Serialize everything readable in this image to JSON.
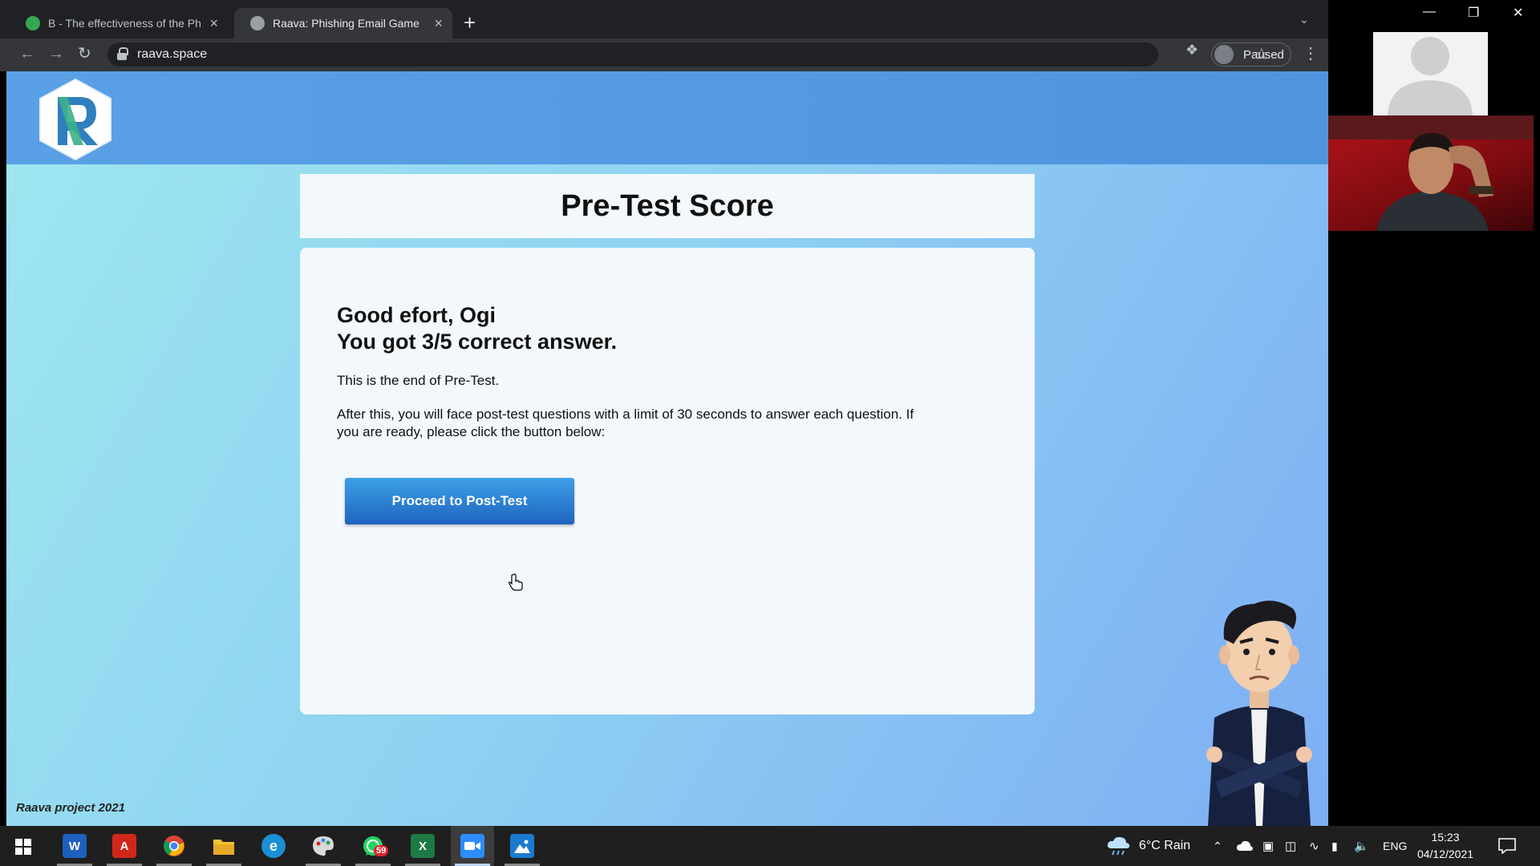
{
  "browser": {
    "tabs": [
      {
        "title": "B - The effectiveness of the Ph",
        "favicon": "drive-icon",
        "active": false
      },
      {
        "title": "Raava: Phishing Email Game",
        "favicon": "globe-icon",
        "active": true
      }
    ],
    "url": "raava.space",
    "profile_label": "Paused"
  },
  "page": {
    "title": "Pre-Test Score",
    "greeting_line1": "Good efort, Ogi",
    "greeting_line2": "You got 3/5 correct answer.",
    "end_text": "This is the end of Pre-Test.",
    "instructions": "After this, you will face post-test questions with a limit of 30 seconds to answer each question. If you are ready, please click the button below:",
    "button_label": "Proceed to Post-Test",
    "footer": "Raava project 2021",
    "colors": {
      "header": "#5aa0e6",
      "button": "#1f64bf",
      "card": "#f3f8fd"
    }
  },
  "taskbar": {
    "apps": [
      {
        "name": "Word",
        "glyph": "W",
        "color": "#1f5fbf"
      },
      {
        "name": "Acrobat",
        "glyph": "A",
        "color": "#d1271b"
      },
      {
        "name": "Chrome",
        "glyph": "",
        "color": "#e8eaed"
      },
      {
        "name": "File Explorer",
        "glyph": "",
        "color": "#f3c332"
      },
      {
        "name": "Edge",
        "glyph": "e",
        "color": "#1a8fd6"
      },
      {
        "name": "Paint",
        "glyph": "",
        "color": "#d9d9d9"
      },
      {
        "name": "WhatsApp",
        "glyph": "",
        "color": "#25d366",
        "badge": "59"
      },
      {
        "name": "Excel",
        "glyph": "X",
        "color": "#1d7a44"
      },
      {
        "name": "Zoom",
        "glyph": "",
        "color": "#2d8cff"
      },
      {
        "name": "Photos",
        "glyph": "",
        "color": "#1b7ad0"
      }
    ],
    "weather": "6°C Rain",
    "language": "ENG",
    "time": "15:23",
    "date": "04/12/2021"
  }
}
